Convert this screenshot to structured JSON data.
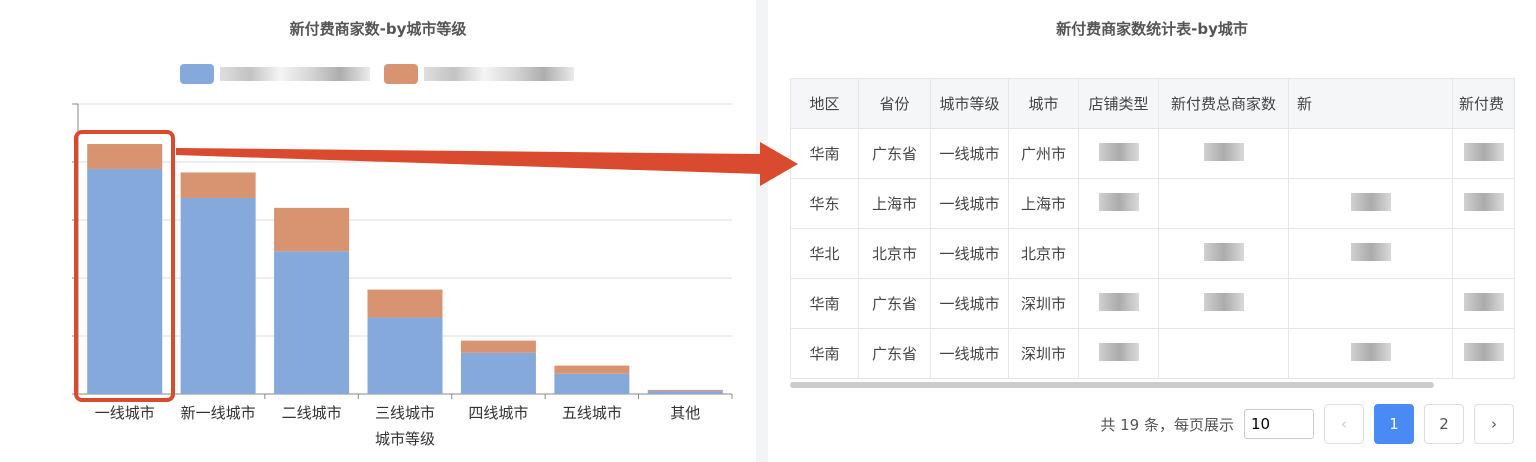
{
  "left": {
    "title": "新付费商家数-by城市等级",
    "legend": [
      {
        "name": "",
        "color": "#86a9dc"
      },
      {
        "name": "",
        "color": "#d89470"
      }
    ]
  },
  "chart_data": {
    "type": "bar",
    "stacked": true,
    "categories": [
      "一线城市",
      "新一线城市",
      "二线城市",
      "三线城市",
      "四线城市",
      "五线城市",
      "其他"
    ],
    "series": [
      {
        "values": [
          388,
          338,
          246,
          132,
          71,
          35,
          5
        ],
        "color": "#86a9dc"
      },
      {
        "values": [
          43,
          44,
          75,
          48,
          21,
          14,
          2
        ],
        "color": "#d89470"
      }
    ],
    "xlabel": "城市等级",
    "ylim": [
      0,
      500
    ],
    "grid": true
  },
  "right": {
    "title": "新付费商家数统计表-by城市",
    "headers": [
      "地区",
      "省份",
      "城市等级",
      "城市",
      "店铺类型",
      "新付费总商家数",
      "新",
      "新付费"
    ],
    "rows": [
      [
        "华南",
        "广东省",
        "一线城市",
        "广州市"
      ],
      [
        "华东",
        "上海市",
        "一线城市",
        "上海市"
      ],
      [
        "华北",
        "北京市",
        "一线城市",
        "北京市"
      ],
      [
        "华南",
        "广东省",
        "一线城市",
        "深圳市"
      ],
      [
        "华南",
        "广东省",
        "一线城市",
        "深圳市"
      ]
    ],
    "pagination": {
      "total_text": "共 19 条，每页展示",
      "page_size": "10",
      "prev": "‹",
      "pages": [
        "1",
        "2"
      ],
      "next": "›"
    }
  },
  "colors": {
    "highlight": "#d94a2e",
    "arrow": "#d94a2e",
    "active": "#4a8af4"
  }
}
